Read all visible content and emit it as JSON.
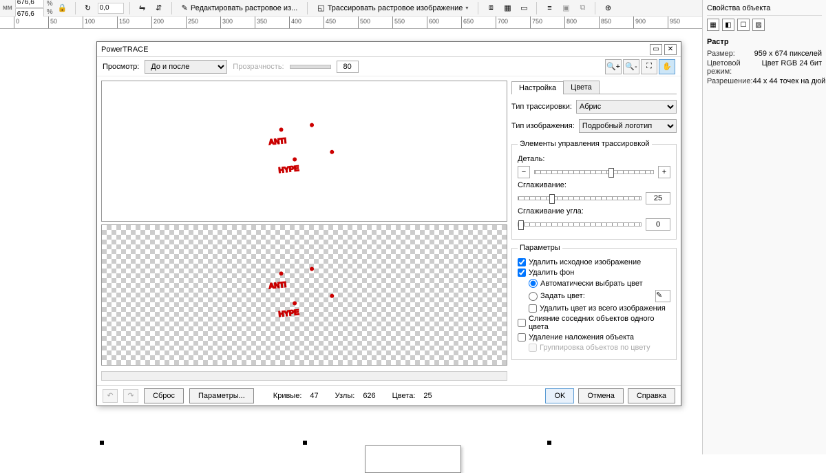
{
  "topbar": {
    "unit1": "мм",
    "unit2": "мм",
    "size_w": "676,6",
    "size_h": "676,6",
    "pct1": "%",
    "pct2": "%",
    "rotate": "0,0",
    "edit_raster": "Редактировать растровое из...",
    "trace_raster": "Трассировать растровое изображение"
  },
  "ruler": {
    "unit": "миллиметры",
    "ticks": [
      "0",
      "50",
      "100",
      "150",
      "200",
      "250",
      "300",
      "350",
      "400",
      "450",
      "500",
      "550",
      "600",
      "650",
      "700",
      "750",
      "800",
      "850",
      "900",
      "950"
    ]
  },
  "docker": {
    "title": "Свойства объекта",
    "section": "Растр",
    "size_k": "Размер:",
    "size_v": "959 x 674 пикселей",
    "mode_k": "Цветовой режим:",
    "mode_v": "Цвет RGB 24 бит",
    "res_k": "Разрешение:",
    "res_v": "44 x 44 точек на дюйм"
  },
  "dialog": {
    "title": "PowerTRACE",
    "preview_label": "Просмотр:",
    "preview_select": "До и после",
    "transparency_label": "Прозрачность:",
    "transparency_value": "80",
    "tabs": {
      "settings": "Настройка",
      "colors": "Цвета"
    },
    "trace_type_label": "Тип трассировки:",
    "trace_type_value": "Абрис",
    "image_type_label": "Тип изображения:",
    "image_type_value": "Подробный логотип",
    "controls_legend": "Элементы управления трассировкой",
    "detail_label": "Деталь:",
    "smoothing_label": "Сглаживание:",
    "smoothing_value": "25",
    "corner_label": "Сглаживание угла:",
    "corner_value": "0",
    "options_legend": "Параметры",
    "opt_delete_source": "Удалить исходное изображение",
    "opt_delete_bg": "Удалить фон",
    "opt_auto_color": "Автоматически выбрать цвет",
    "opt_set_color": "Задать цвет:",
    "opt_remove_color_all": "Удалить цвет из всего изображения",
    "opt_merge_adjacent": "Слияние соседних объектов одного цвета",
    "opt_remove_overlap": "Удаление наложения объекта",
    "opt_group_by_color": "Группировка объектов по цвету",
    "footer": {
      "reset": "Сброс",
      "params": "Параметры...",
      "curves_label": "Кривые:",
      "curves_val": "47",
      "nodes_label": "Узлы:",
      "nodes_val": "626",
      "colors_label": "Цвета:",
      "colors_val": "25",
      "ok": "OK",
      "cancel": "Отмена",
      "help": "Справка"
    }
  },
  "logo": {
    "line1": "ANTI",
    "line2": "HYPE"
  }
}
